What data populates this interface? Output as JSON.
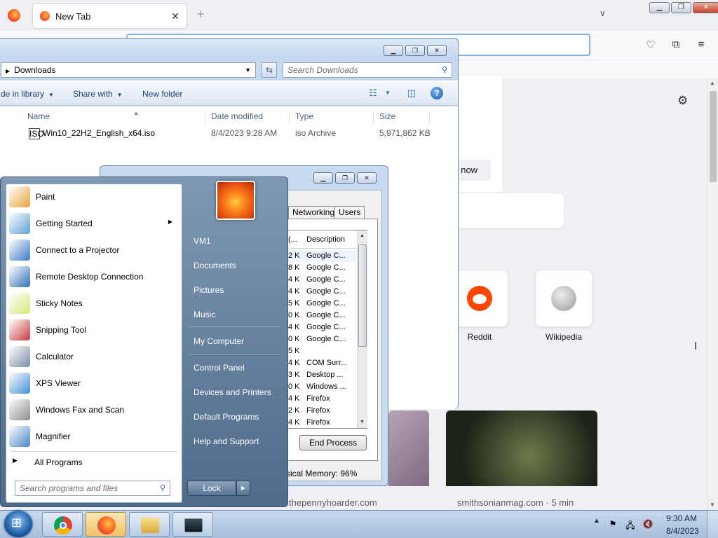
{
  "firefox": {
    "tab_title": "New Tab",
    "new_tab_symbol": "+",
    "list_tabs_symbol": "∨",
    "promo_button": "t now",
    "shortcuts": [
      {
        "label": "Reddit"
      },
      {
        "label": "Wikipedia"
      }
    ],
    "stories": [
      {
        "source": "thepennyhoarder.com"
      },
      {
        "source": "smithsonianmag.com · 5 min"
      }
    ]
  },
  "explorer": {
    "address": "Downloads",
    "search_placeholder": "Search Downloads",
    "commands": {
      "include_in_library": "de in library",
      "share_with": "Share with",
      "new_folder": "New folder"
    },
    "columns": [
      "Name",
      "Date modified",
      "Type",
      "Size"
    ],
    "files": [
      {
        "name": "Win10_22H2_English_x64.iso",
        "date": "8/4/2023 9:28 AM",
        "type": "iso Archive",
        "size": "5,971,862 KB",
        "icon_text": "ISO"
      }
    ]
  },
  "task_manager": {
    "tabs": [
      "Networking",
      "Users"
    ],
    "columns": [
      "(...",
      "Description"
    ],
    "rows": [
      {
        "mem": "2 K",
        "desc": "Google C..."
      },
      {
        "mem": "8 K",
        "desc": "Google C..."
      },
      {
        "mem": "4 K",
        "desc": "Google C..."
      },
      {
        "mem": "4 K",
        "desc": "Google C..."
      },
      {
        "mem": "5 K",
        "desc": "Google C..."
      },
      {
        "mem": "0 K",
        "desc": "Google C..."
      },
      {
        "mem": "4 K",
        "desc": "Google C..."
      },
      {
        "mem": "0 K",
        "desc": "Google C..."
      },
      {
        "mem": "5 K",
        "desc": ""
      },
      {
        "mem": "4 K",
        "desc": "COM Surr..."
      },
      {
        "mem": "3 K",
        "desc": "Desktop ..."
      },
      {
        "mem": "0 K",
        "desc": "Windows ..."
      },
      {
        "mem": "4 K",
        "desc": "Firefox"
      },
      {
        "mem": "2 K",
        "desc": "Firefox"
      },
      {
        "mem": "4 K",
        "desc": "Firefox"
      }
    ],
    "end_process": "End Process",
    "status": "sical Memory: 96%"
  },
  "start_menu": {
    "programs": [
      {
        "label": "Paint",
        "icon": "paint-icon",
        "color": "#e8a33a"
      },
      {
        "label": "Getting Started",
        "icon": "getting-started-icon",
        "color": "#5aa0d8",
        "submenu": "▶"
      },
      {
        "label": "Connect to a Projector",
        "icon": "projector-icon",
        "color": "#3a7bc8"
      },
      {
        "label": "Remote Desktop Connection",
        "icon": "remote-desktop-icon",
        "color": "#2f6fb7"
      },
      {
        "label": "Sticky Notes",
        "icon": "sticky-notes-icon",
        "color": "#d9e87a"
      },
      {
        "label": "Snipping Tool",
        "icon": "snipping-tool-icon",
        "color": "#c63b3b"
      },
      {
        "label": "Calculator",
        "icon": "calculator-icon",
        "color": "#7a8da6"
      },
      {
        "label": "XPS Viewer",
        "icon": "xps-viewer-icon",
        "color": "#3f8fd8"
      },
      {
        "label": "Windows Fax and Scan",
        "icon": "fax-scan-icon",
        "color": "#8c8c8c"
      },
      {
        "label": "Magnifier",
        "icon": "magnifier-icon",
        "color": "#4a86c8"
      }
    ],
    "all_programs": "All Programs",
    "search_placeholder": "Search programs and files",
    "right_items": [
      "VM1",
      "Documents",
      "Pictures",
      "Music",
      "My Computer",
      "Control Panel",
      "Devices and Printers",
      "Default Programs",
      "Help and Support"
    ],
    "lock": "Lock"
  },
  "taskbar": {
    "time": "9:30 AM",
    "date": "8/4/2023",
    "tray_expand": "▲"
  }
}
